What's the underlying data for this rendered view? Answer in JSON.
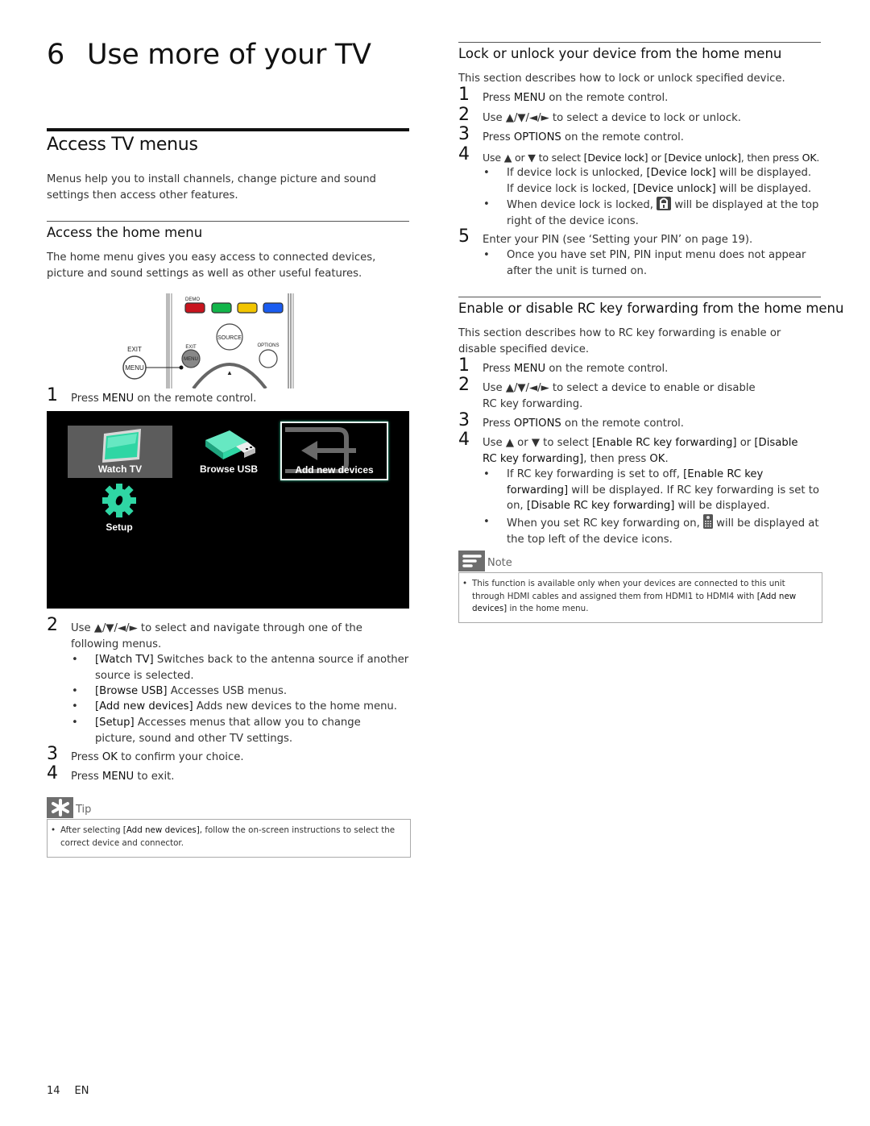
{
  "chapter": {
    "number": "6",
    "title": "Use more of your TV"
  },
  "left": {
    "section_title": "Access TV menus",
    "intro": "Menus help you to install channels, change picture and sound settings then access other features.",
    "subsection_title": "Access the home menu",
    "subsection_intro": "The home menu gives you easy access to connected devices, picture and sound settings as well as other useful features.",
    "remote": {
      "labels": {
        "demo": "DEMO",
        "source": "SOURCE",
        "exit_small": "EXIT",
        "menu_small": "MENU",
        "options": "OPTIONS",
        "exit_big": "EXIT",
        "menu_big": "MENU",
        "up": "▲"
      },
      "color_keys": [
        "#c8141e",
        "#12b54a",
        "#f2c500",
        "#1a5cf0"
      ]
    },
    "step1": {
      "num": "1",
      "text_a": "Press ",
      "key": "MENU",
      "text_b": " on the remote control."
    },
    "home_menu": {
      "items": [
        {
          "label": "Watch TV",
          "icon": "tv-icon",
          "highlighted": true
        },
        {
          "label": "Browse USB",
          "icon": "usb-icon",
          "highlighted": false
        },
        {
          "label": "Add new devices",
          "icon": "input-icon",
          "selected": true
        },
        {
          "label": "Setup",
          "icon": "gear-icon",
          "highlighted": false
        }
      ],
      "accent": "#2fd6a4"
    },
    "step2": {
      "num": "2",
      "text": "Use ▲/▼/◄/► to select and navigate through one of the following menus."
    },
    "bullets": [
      {
        "key": "[Watch TV]",
        "text": " Switches back to the antenna source if another source is selected."
      },
      {
        "key": "[Browse USB]",
        "text": " Accesses USB menus."
      },
      {
        "key": "[Add new devices]",
        "text": " Adds new devices to the home menu."
      },
      {
        "key": "[Setup]",
        "text": " Accesses menus that allow you to change picture, sound and other TV settings."
      }
    ],
    "step3": {
      "num": "3",
      "text_a": "Press ",
      "key": "OK",
      "text_b": " to confirm your choice."
    },
    "step4": {
      "num": "4",
      "text_a": "Press ",
      "key": "MENU",
      "text_b": " to exit."
    },
    "tip": {
      "label": "Tip",
      "text_a": "After selecting ",
      "key": "[Add new devices]",
      "text_b": ", follow the on-screen instructions to select the correct device and connector."
    }
  },
  "right": {
    "lock": {
      "title": "Lock or unlock your device from the home menu",
      "intro": "This section describes how to lock or unlock specified device.",
      "steps": [
        {
          "num": "1",
          "text_a": "Press ",
          "key": "MENU",
          "text_b": " on the remote control."
        },
        {
          "num": "2",
          "text_a": "Use ▲/▼/◄/► to select a device to lock or unlock.",
          "key": "",
          "text_b": ""
        },
        {
          "num": "3",
          "text_a": "Press ",
          "key": "OPTIONS",
          "text_b": " on the remote control."
        },
        {
          "num": "4",
          "text_a": "Use ▲ or ▼ to select ",
          "key": "[Device lock]",
          "text_mid": " or ",
          "key2": "[Device unlock]",
          "text_b": ", then press ",
          "key3": "OK",
          "text_c": "."
        }
      ],
      "bullet1_line1_a": "If device lock is unlocked, ",
      "bullet1_line1_key": "[Device lock]",
      "bullet1_line1_b": " will be displayed.",
      "bullet1_line2_a": "If device lock is locked, ",
      "bullet1_line2_key": "[Device unlock]",
      "bullet1_line2_b": " will be displayed.",
      "bullet2_a": "When device lock is locked, ",
      "bullet2_b": " will be displayed at the top right of the device icons.",
      "step5": {
        "num": "5",
        "text": "Enter your PIN (see ‘Setting your PIN’ on page 19)."
      },
      "bullet3": "Once you have set PIN, PIN input menu does not appear after the unit is turned on."
    },
    "rc": {
      "title": "Enable or disable RC key forwarding from the home menu",
      "intro": "This section describes how to RC key forwarding is enable or disable specified device.",
      "step1": {
        "num": "1",
        "text_a": "Press ",
        "key": "MENU",
        "text_b": " on the remote control."
      },
      "step2": {
        "num": "2",
        "text": "Use ▲/▼/◄/► to select a device to enable or disable RC key forwarding."
      },
      "step3": {
        "num": "3",
        "text_a": "Press ",
        "key": "OPTIONS",
        "text_b": " on the remote control."
      },
      "step4": {
        "num": "4",
        "text_a": "Use ▲ or ▼ to select ",
        "key": "[Enable RC key forwarding]",
        "text_mid": " or ",
        "key2": "[Disable RC key forwarding]",
        "text_b": ", then press ",
        "key3": "OK",
        "text_c": "."
      },
      "bullet1_a": "If RC key forwarding is  set to off, ",
      "bullet1_key": "[Enable RC key forwarding]",
      "bullet1_b": " will be displayed. If RC key forwarding is set to on, ",
      "bullet1_key2": "[Disable RC key forwarding]",
      "bullet1_c": " will be displayed.",
      "bullet2_a": "When you set RC key forwarding on, ",
      "bullet2_b": " will be displayed at the top left of the device icons."
    },
    "note": {
      "label": "Note",
      "text_a": "This function is available only when your devices are connected to this unit through HDMI cables and assigned them from HDMI1 to HDMI4 with ",
      "key": "[Add new devices]",
      "text_b": " in the home menu."
    }
  },
  "footer": {
    "page": "14",
    "lang": "EN"
  }
}
